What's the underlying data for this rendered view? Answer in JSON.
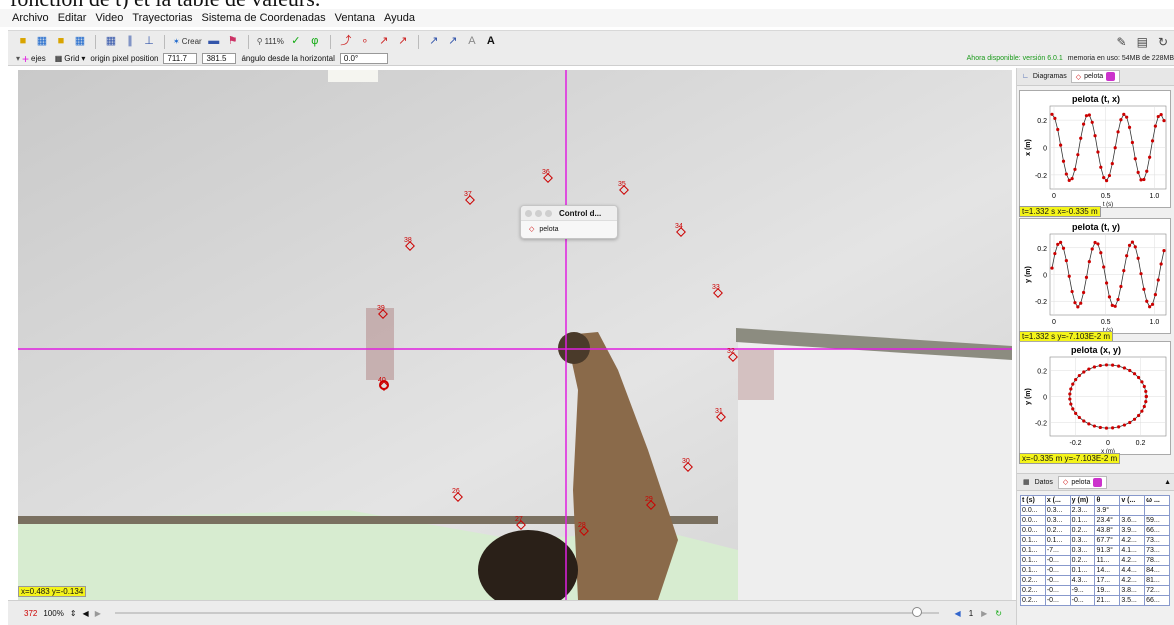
{
  "caption": "fonction de t) et la table de valeurs.",
  "menu": [
    "Archivo",
    "Editar",
    "Video",
    "Trayectorias",
    "Sistema de Coordenadas",
    "Ventana",
    "Ayuda"
  ],
  "toolbar": {
    "create_label": "Crear",
    "zoom_label": "111%",
    "memory_text": "memoria en uso: 54MB de 228MB",
    "available_text": "Ahora disponible: versión 6.0.1"
  },
  "coords": {
    "axes_label": "ejes",
    "grid_label": "Grid",
    "origin_label": "origin pixel position",
    "origin_x": "711.7",
    "origin_y": "381.5",
    "angle_label": "ángulo desde la horizontal",
    "angle_value": "0.0°"
  },
  "video": {
    "trail": [
      {
        "n": "26"
      },
      {
        "n": "27"
      },
      {
        "n": "28"
      },
      {
        "n": "29"
      },
      {
        "n": "30"
      },
      {
        "n": "31"
      },
      {
        "n": "32"
      },
      {
        "n": "33"
      },
      {
        "n": "34"
      },
      {
        "n": "35"
      },
      {
        "n": "36"
      },
      {
        "n": "37"
      },
      {
        "n": "38"
      },
      {
        "n": "39"
      },
      {
        "n": "40"
      }
    ],
    "readout": "x=0.483  y=-0.134",
    "axis_color": "#e020e0",
    "marker_color": "#cc0000"
  },
  "control_popup": {
    "title": "Control d...",
    "track": "pelota"
  },
  "player": {
    "frame": "372",
    "zoom": "100%",
    "step": "1",
    "slider_fraction": 0.98
  },
  "panel": {
    "diagramas_tab": "Diagramas",
    "track_tab": "pelota",
    "plots": [
      {
        "title": "pelota (t, x)",
        "ylabel": "x (m)",
        "xlabel": "t (s)",
        "readout": "t=1.332 s  x=-0.335 m",
        "yticks": [
          "0.2",
          "0",
          "-0.2"
        ],
        "xticks": [
          "0",
          "0.5",
          "1.0"
        ]
      },
      {
        "title": "pelota (t, y)",
        "ylabel": "y (m)",
        "xlabel": "t (s)",
        "readout": "t=1.332 s  y=-7.103E-2 m",
        "yticks": [
          "0.2",
          "0",
          "-0.2"
        ],
        "xticks": [
          "0",
          "0.5",
          "1.0"
        ]
      },
      {
        "title": "pelota (x, y)",
        "ylabel": "y (m)",
        "xlabel": "x (m)",
        "readout": "x=-0.335 m  y=-7.103E-2 m",
        "yticks": [
          "0.2",
          "0",
          "-0.2"
        ],
        "xticks": [
          "-0.2",
          "0",
          "0.2"
        ]
      }
    ],
    "data_tab": "Datos",
    "data_track": "pelota",
    "table": {
      "headers": [
        "t (s)",
        "x (...",
        "y (m)",
        "θ",
        "v (...",
        "ω ..."
      ],
      "rows": [
        [
          "0.0...",
          "0.3...",
          "2.3...",
          "3.9°",
          "",
          ""
        ],
        [
          "0.0...",
          "0.3...",
          "0.1...",
          "23.4°",
          "3.6...",
          "59..."
        ],
        [
          "0.0...",
          "0.2...",
          "0.2...",
          "43.8°",
          "3.9...",
          "66..."
        ],
        [
          "0.1...",
          "0.1...",
          "0.3...",
          "67.7°",
          "4.2...",
          "73..."
        ],
        [
          "0.1...",
          "-7...",
          "0.3...",
          "91.3°",
          "4.1...",
          "73..."
        ],
        [
          "0.1...",
          "-0...",
          "0.2...",
          "11...",
          "4.2...",
          "78..."
        ],
        [
          "0.1...",
          "-0...",
          "0.1...",
          "14...",
          "4.4...",
          "84..."
        ],
        [
          "0.2...",
          "-0...",
          "4.3...",
          "17...",
          "4.2...",
          "81..."
        ],
        [
          "0.2...",
          "-0...",
          "-9...",
          "19...",
          "3.8...",
          "72..."
        ],
        [
          "0.2...",
          "-0...",
          "-0...",
          "21...",
          "3.5...",
          "66..."
        ]
      ]
    }
  }
}
